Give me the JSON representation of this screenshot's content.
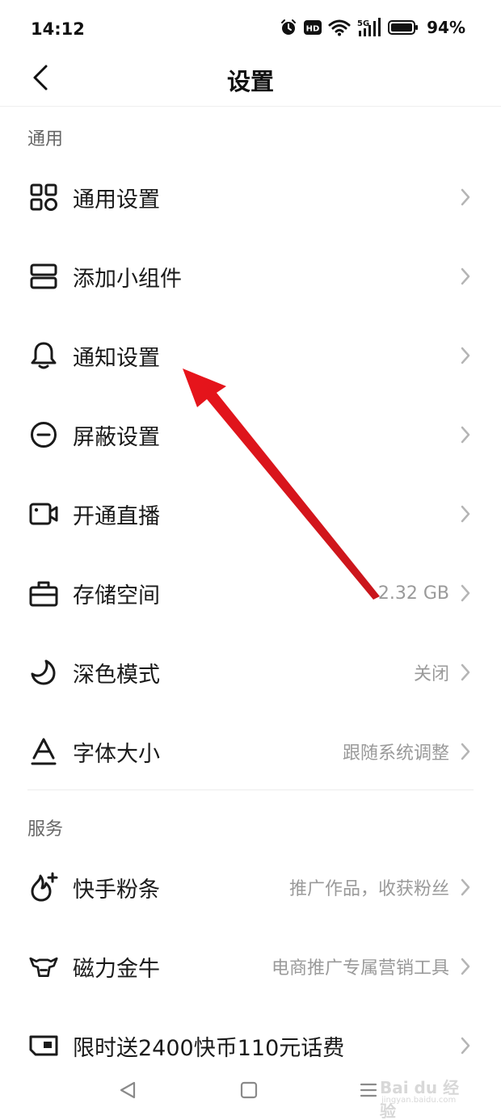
{
  "status_bar": {
    "time": "14:12",
    "network": "5G",
    "hd_badge": "HD",
    "battery": "94%",
    "icons": [
      "alarm-icon",
      "hd-icon",
      "wifi-icon",
      "signal-5g-icon",
      "battery-icon"
    ]
  },
  "header": {
    "title": "设置",
    "back_icon": "chevron-left-icon"
  },
  "sections": {
    "general": {
      "title": "通用",
      "items": [
        {
          "label": "通用设置",
          "value": "",
          "icon": "grid-icon"
        },
        {
          "label": "添加小组件",
          "value": "",
          "icon": "widget-icon"
        },
        {
          "label": "通知设置",
          "value": "",
          "icon": "bell-icon"
        },
        {
          "label": "屏蔽设置",
          "value": "",
          "icon": "block-icon"
        },
        {
          "label": "开通直播",
          "value": "",
          "icon": "video-camera-icon"
        },
        {
          "label": "存储空间",
          "value": "2.32 GB",
          "icon": "storage-icon"
        },
        {
          "label": "深色模式",
          "value": "关闭",
          "icon": "moon-icon"
        },
        {
          "label": "字体大小",
          "value": "跟随系统调整",
          "icon": "font-size-icon"
        }
      ]
    },
    "services": {
      "title": "服务",
      "items": [
        {
          "label": "快手粉条",
          "value": "推广作品，收获粉丝",
          "icon": "fan-boost-icon"
        },
        {
          "label": "磁力金牛",
          "value": "电商推广专属营销工具",
          "icon": "bull-icon"
        },
        {
          "label": "限时送2400快币110元话费",
          "value": "",
          "icon": "wallet-icon"
        }
      ]
    }
  },
  "watermark": {
    "text": "Bai du 经验",
    "sub": "jingyan.baidu.com"
  },
  "colors": {
    "arrow": "#e8141b",
    "text_primary": "#1a1a1a",
    "text_secondary": "#9a9a9a",
    "section_header": "#666666",
    "divider": "#ececec"
  }
}
